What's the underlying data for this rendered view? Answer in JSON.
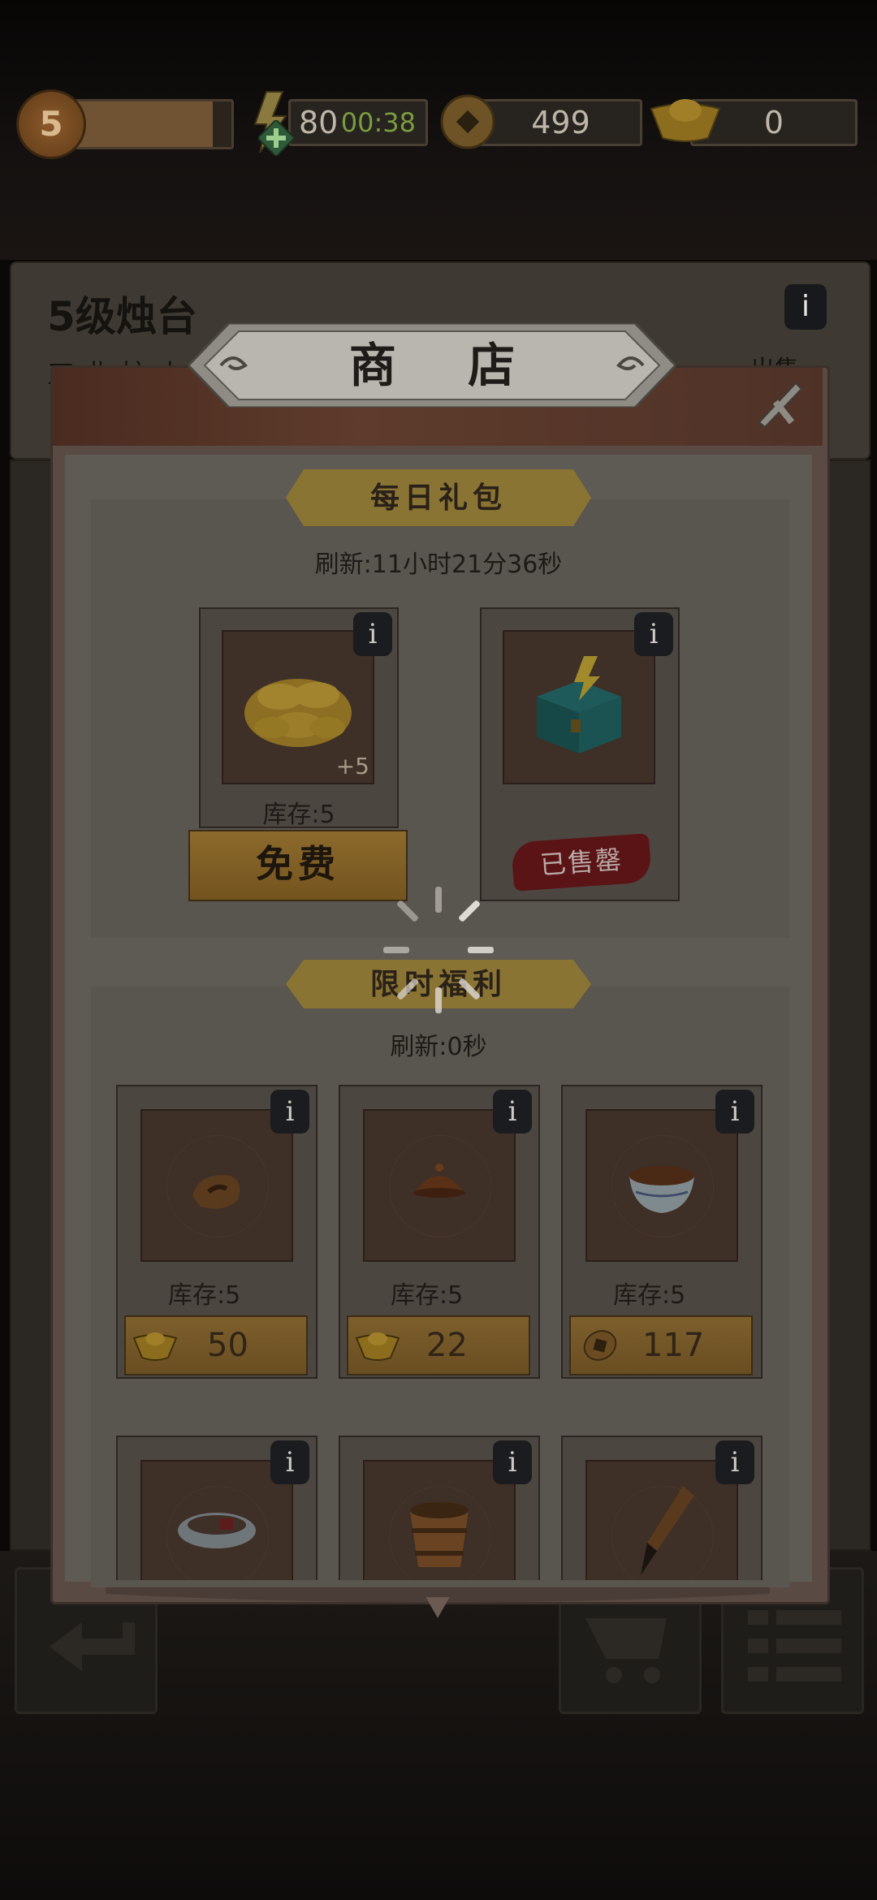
{
  "background": {
    "panel_title": "5级烛台",
    "panel_sub_left": "工 业 炉 火",
    "panel_sub_right": "出售",
    "info": "i"
  },
  "status": {
    "level": "5",
    "xp_fraction": 0.88,
    "energy": "80",
    "energy_timer": "00:38",
    "coins": "499",
    "gold": "0"
  },
  "shop": {
    "title": "商 店",
    "close_icon": "close-icon",
    "daily": {
      "label": "每日礼包",
      "refresh": "刷新:11小时21分36秒",
      "items": [
        {
          "name": "gold-ingots",
          "stock": "库存:5",
          "badge": "+5",
          "action": "免费",
          "info": "i"
        },
        {
          "name": "energy-chest",
          "status": "已售罄",
          "info": "i"
        }
      ]
    },
    "limited": {
      "label": "限时福利",
      "refresh": "刷新:0秒",
      "items": [
        {
          "name": "wood-ring",
          "stock": "库存:5",
          "price": "50",
          "currency": "gold-ingot-icon",
          "info": "i"
        },
        {
          "name": "bronze-bowl",
          "stock": "库存:5",
          "price": "22",
          "currency": "gold-ingot-icon",
          "info": "i"
        },
        {
          "name": "porcelain-bowl",
          "stock": "库存:5",
          "price": "117",
          "currency": "copper-coin-icon",
          "info": "i"
        },
        {
          "name": "silver-bracelet",
          "info": "i"
        },
        {
          "name": "wooden-bucket",
          "info": "i"
        },
        {
          "name": "ink-brush",
          "info": "i"
        }
      ]
    }
  },
  "colors": {
    "gold": "#c9a23a",
    "energy_timer": "#7a9c3e",
    "sold_red": "#5a1416"
  }
}
